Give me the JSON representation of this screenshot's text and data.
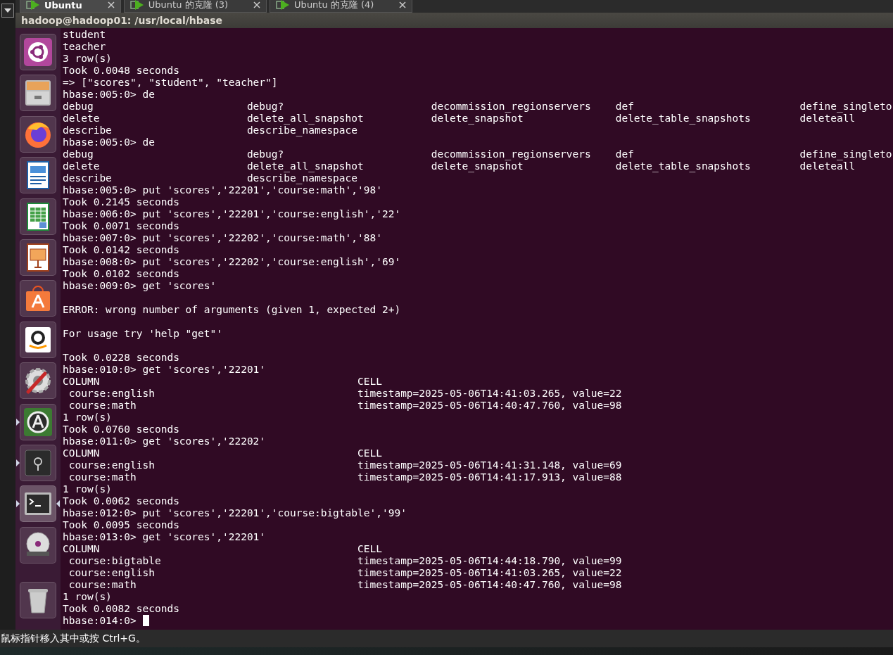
{
  "tabs": [
    {
      "label": "Ubuntu",
      "selected": true
    },
    {
      "label": "Ubuntu 的克隆 (3)",
      "selected": false
    },
    {
      "label": "Ubuntu 的克隆 (4)",
      "selected": false
    }
  ],
  "window": {
    "title": "hadoop@hadoop01: /usr/local/hbase"
  },
  "launcher": {
    "items": [
      {
        "kind": "ubuntu",
        "running": false,
        "focused": false
      },
      {
        "kind": "files",
        "running": false,
        "focused": false
      },
      {
        "kind": "firefox",
        "running": false,
        "focused": false
      },
      {
        "kind": "writer",
        "running": false,
        "focused": false
      },
      {
        "kind": "calc",
        "running": false,
        "focused": false
      },
      {
        "kind": "impress",
        "running": false,
        "focused": false
      },
      {
        "kind": "store",
        "running": false,
        "focused": false
      },
      {
        "kind": "amazon",
        "running": false,
        "focused": false
      },
      {
        "kind": "settings",
        "running": false,
        "focused": false
      },
      {
        "kind": "updater",
        "running": true,
        "focused": false
      },
      {
        "kind": "safe",
        "running": true,
        "focused": false
      },
      {
        "kind": "terminal",
        "running": true,
        "focused": true
      },
      {
        "kind": "dvd",
        "running": false,
        "focused": false
      },
      {
        "kind": "trash",
        "running": false,
        "focused": false
      }
    ]
  },
  "terminal": {
    "cursor": true,
    "lines": [
      {
        "text": "student",
        "gap_before": false
      },
      {
        "text": "teacher",
        "gap_before": false
      },
      {
        "text": "3 row(s)",
        "gap_before": false
      },
      {
        "text": "Took 0.0048 seconds",
        "gap_before": false
      },
      {
        "text": "=> [\"scores\", \"student\", \"teacher\"]",
        "gap_before": false
      },
      {
        "text": "hbase:005:0> de",
        "gap_before": false
      },
      {
        "text": "debug                         debug?                        decommission_regionservers    def                           define_singleto",
        "gap_before": false
      },
      {
        "text": "delete                        delete_all_snapshot           delete_snapshot               delete_table_snapshots        deleteall",
        "gap_before": false
      },
      {
        "text": "describe                      describe_namespace",
        "gap_before": false
      },
      {
        "text": "hbase:005:0> de",
        "gap_before": false
      },
      {
        "text": "debug                         debug?                        decommission_regionservers    def                           define_singleto",
        "gap_before": false
      },
      {
        "text": "delete                        delete_all_snapshot           delete_snapshot               delete_table_snapshots        deleteall",
        "gap_before": false
      },
      {
        "text": "describe                      describe_namespace",
        "gap_before": false
      },
      {
        "text": "hbase:005:0> put 'scores','22201','course:math','98'",
        "gap_before": false
      },
      {
        "text": "Took 0.2145 seconds",
        "gap_before": false
      },
      {
        "text": "hbase:006:0> put 'scores','22201','course:english','22'",
        "gap_before": false
      },
      {
        "text": "Took 0.0071 seconds",
        "gap_before": false
      },
      {
        "text": "hbase:007:0> put 'scores','22202','course:math','88'",
        "gap_before": false
      },
      {
        "text": "Took 0.0142 seconds",
        "gap_before": false
      },
      {
        "text": "hbase:008:0> put 'scores','22202','course:english','69'",
        "gap_before": false
      },
      {
        "text": "Took 0.0102 seconds",
        "gap_before": false
      },
      {
        "text": "hbase:009:0> get 'scores'",
        "gap_before": false
      },
      {
        "text": "ERROR: wrong number of arguments (given 1, expected 2+)",
        "gap_before": true
      },
      {
        "text": "For usage try 'help \"get\"'",
        "gap_before": true
      },
      {
        "text": "Took 0.0228 seconds",
        "gap_before": true
      },
      {
        "text": "hbase:010:0> get 'scores','22201'",
        "gap_before": false
      },
      {
        "text": "COLUMN                                          CELL",
        "gap_before": false
      },
      {
        "text": " course:english                                 timestamp=2025-05-06T14:41:03.265, value=22",
        "gap_before": false
      },
      {
        "text": " course:math                                    timestamp=2025-05-06T14:40:47.760, value=98",
        "gap_before": false
      },
      {
        "text": "1 row(s)",
        "gap_before": false
      },
      {
        "text": "Took 0.0760 seconds",
        "gap_before": false
      },
      {
        "text": "hbase:011:0> get 'scores','22202'",
        "gap_before": false
      },
      {
        "text": "COLUMN                                          CELL",
        "gap_before": false
      },
      {
        "text": " course:english                                 timestamp=2025-05-06T14:41:31.148, value=69",
        "gap_before": false
      },
      {
        "text": " course:math                                    timestamp=2025-05-06T14:41:17.913, value=88",
        "gap_before": false
      },
      {
        "text": "1 row(s)",
        "gap_before": false
      },
      {
        "text": "Took 0.0062 seconds",
        "gap_before": false
      },
      {
        "text": "hbase:012:0> put 'scores','22201','course:bigtable','99'",
        "gap_before": false
      },
      {
        "text": "Took 0.0095 seconds",
        "gap_before": false
      },
      {
        "text": "hbase:013:0> get 'scores','22201'",
        "gap_before": false
      },
      {
        "text": "COLUMN                                          CELL",
        "gap_before": false
      },
      {
        "text": " course:bigtable                                timestamp=2025-05-06T14:44:18.790, value=99",
        "gap_before": false
      },
      {
        "text": " course:english                                 timestamp=2025-05-06T14:41:03.265, value=22",
        "gap_before": false
      },
      {
        "text": " course:math                                    timestamp=2025-05-06T14:40:47.760, value=98",
        "gap_before": false
      },
      {
        "text": "1 row(s)",
        "gap_before": false
      },
      {
        "text": "Took 0.0082 seconds",
        "gap_before": false
      },
      {
        "text": "hbase:014:0> ",
        "gap_before": false
      }
    ]
  },
  "status_bar": {
    "text": "鼠标指针移入其中或按 Ctrl+G。"
  }
}
